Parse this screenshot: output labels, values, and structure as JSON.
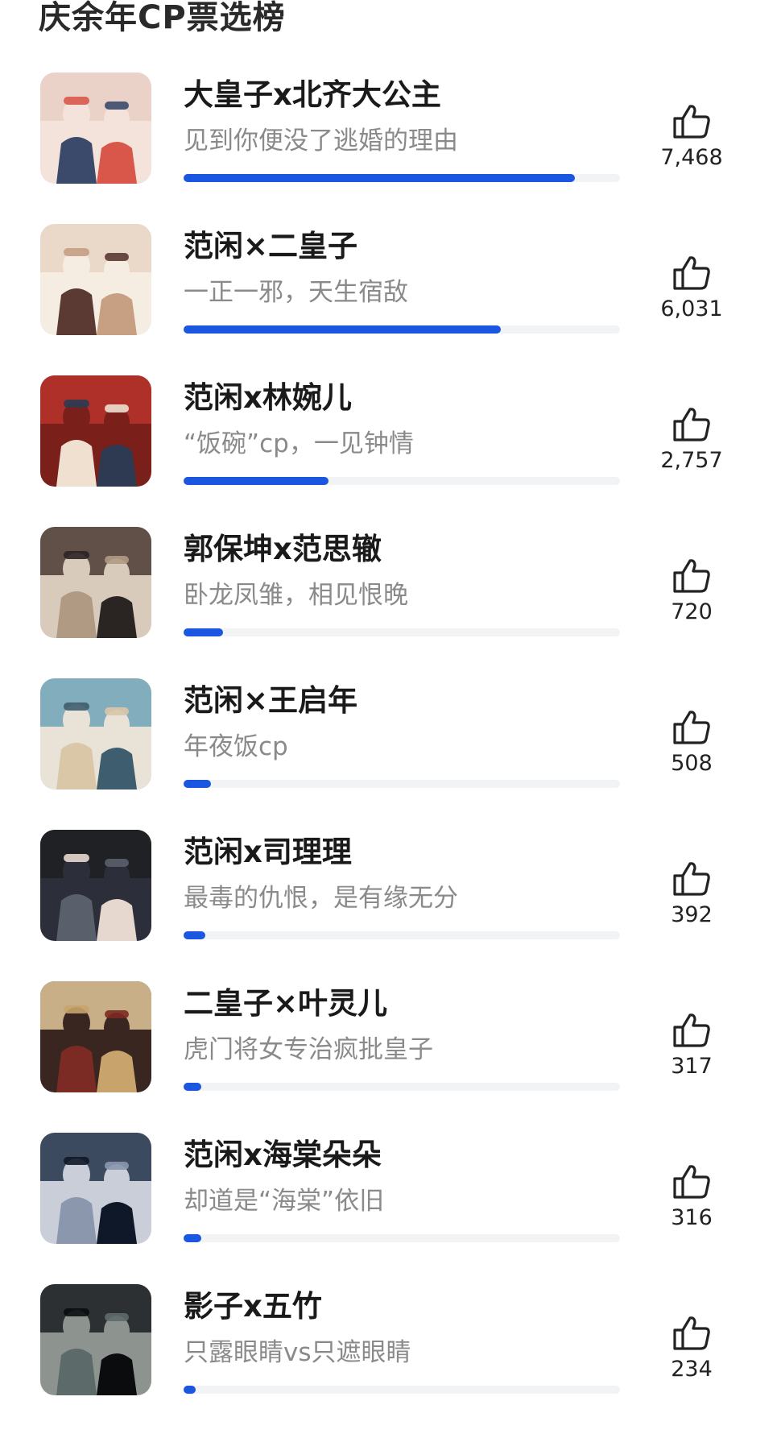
{
  "header": {
    "title": "庆余年CP票选榜"
  },
  "items": [
    {
      "name": "大皇子x北齐大公主",
      "slogan": "见到你便没了逃婚的理由",
      "votes": "7,468",
      "vote_value": 7468,
      "progress": 1.0,
      "thumb_colors": [
        "#e8cfc4",
        "#3b4a6b",
        "#d9574a",
        "#f3e3da"
      ]
    },
    {
      "name": "范闲×二皇子",
      "slogan": "一正一邪，天生宿敌",
      "votes": "6,031",
      "vote_value": 6031,
      "progress": 0.81,
      "thumb_colors": [
        "#e7d5c4",
        "#5a3a33",
        "#c79f83",
        "#f5ece2"
      ]
    },
    {
      "name": "范闲x林婉儿",
      "slogan": "“饭碗”cp，一见钟情",
      "votes": "2,757",
      "vote_value": 2757,
      "progress": 0.37,
      "thumb_colors": [
        "#b8342b",
        "#f0e0d0",
        "#2d3a52",
        "#7a1f1a"
      ]
    },
    {
      "name": "郭保坤x范思辙",
      "slogan": "卧龙凤雏，相见恨晚",
      "votes": "720",
      "vote_value": 720,
      "progress": 0.1,
      "thumb_colors": [
        "#4b3b33",
        "#b09a84",
        "#2a2422",
        "#d8cbbb"
      ]
    },
    {
      "name": "范闲×王启年",
      "slogan": "年夜饭cp",
      "votes": "508",
      "vote_value": 508,
      "progress": 0.07,
      "thumb_colors": [
        "#6fa3b8",
        "#d9c7a8",
        "#3e5d6e",
        "#e9e2d6"
      ]
    },
    {
      "name": "范闲x司理理",
      "slogan": "最毒的仇恨，是有缘无分",
      "votes": "392",
      "vote_value": 392,
      "progress": 0.055,
      "thumb_colors": [
        "#1e1e22",
        "#5a5f6c",
        "#e6d8cf",
        "#2c2f3a"
      ]
    },
    {
      "name": "二皇子×叶灵儿",
      "slogan": "虎门将女专治疯批皇子",
      "votes": "317",
      "vote_value": 317,
      "progress": 0.045,
      "thumb_colors": [
        "#e3c89a",
        "#7b2b23",
        "#c8a46c",
        "#3a2621"
      ]
    },
    {
      "name": "范闲x海棠朵朵",
      "slogan": "却道是“海棠”依旧",
      "votes": "316",
      "vote_value": 316,
      "progress": 0.045,
      "thumb_colors": [
        "#23324a",
        "#8a97ad",
        "#0f1828",
        "#c9ced8"
      ]
    },
    {
      "name": "影子x五竹",
      "slogan": "只露眼睛vs只遮眼睛",
      "votes": "234",
      "vote_value": 234,
      "progress": 0.03,
      "thumb_colors": [
        "#1b1e23",
        "#5d6a6a",
        "#0b0c0e",
        "#8d9490"
      ]
    }
  ]
}
